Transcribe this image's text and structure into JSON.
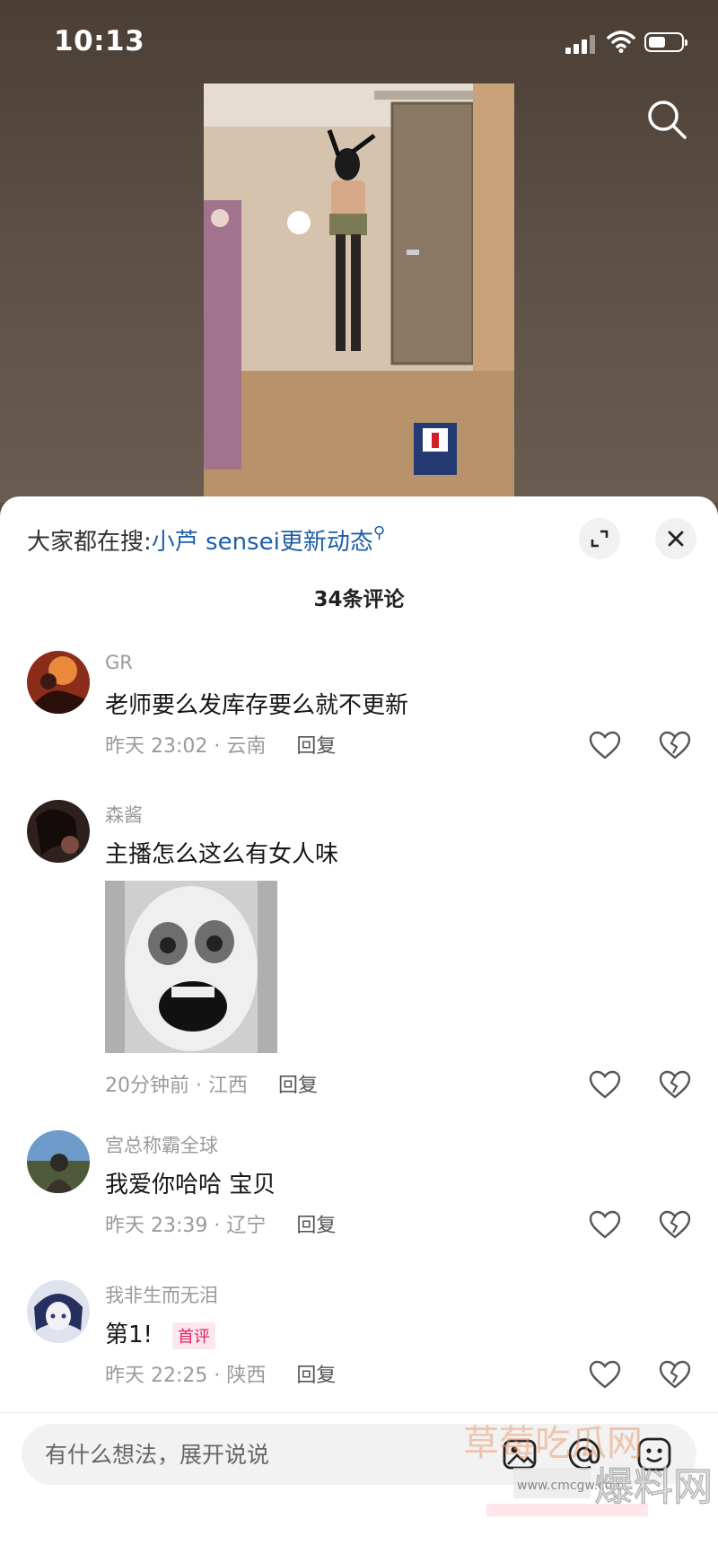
{
  "status_bar": {
    "time": "10:13"
  },
  "hot_search": {
    "prefix": "大家都在搜:",
    "query": "小芦 sensei更新动态"
  },
  "comment_count": "34条评论",
  "comments": [
    {
      "user": "GR",
      "text": "老师要么发库存要么就不更新",
      "meta": "昨天 23:02 · 云南",
      "reply": "回复"
    },
    {
      "user": "森酱",
      "text": "主播怎么这么有女人味",
      "meta": "20分钟前 · 江西",
      "reply": "回复",
      "has_sticker": true
    },
    {
      "user": "宫总称霸全球",
      "text": "我爱你哈哈  宝贝",
      "meta": "昨天 23:39 · 辽宁",
      "reply": "回复"
    },
    {
      "user": "我非生而无泪",
      "text": "第1!",
      "badge": "首评",
      "meta": "昨天 22:25 · 陕西",
      "reply": "回复"
    }
  ],
  "input": {
    "placeholder": "有什么想法，展开说说"
  },
  "watermark": {
    "line1": "草莓吃瓜网",
    "line2": "爆料网",
    "url": "www.cmcgw.com"
  },
  "icons": {
    "search": "search-icon",
    "expand": "expand-icon",
    "close": "close-icon",
    "like": "heart-icon",
    "dislike": "broken-heart-icon",
    "emoji": "emoji-icon",
    "mention": "at-icon",
    "image": "image-icon"
  },
  "colors": {
    "link": "#1e5fa8",
    "badge": "#e0245e",
    "sheet_bg": "#ffffff"
  }
}
